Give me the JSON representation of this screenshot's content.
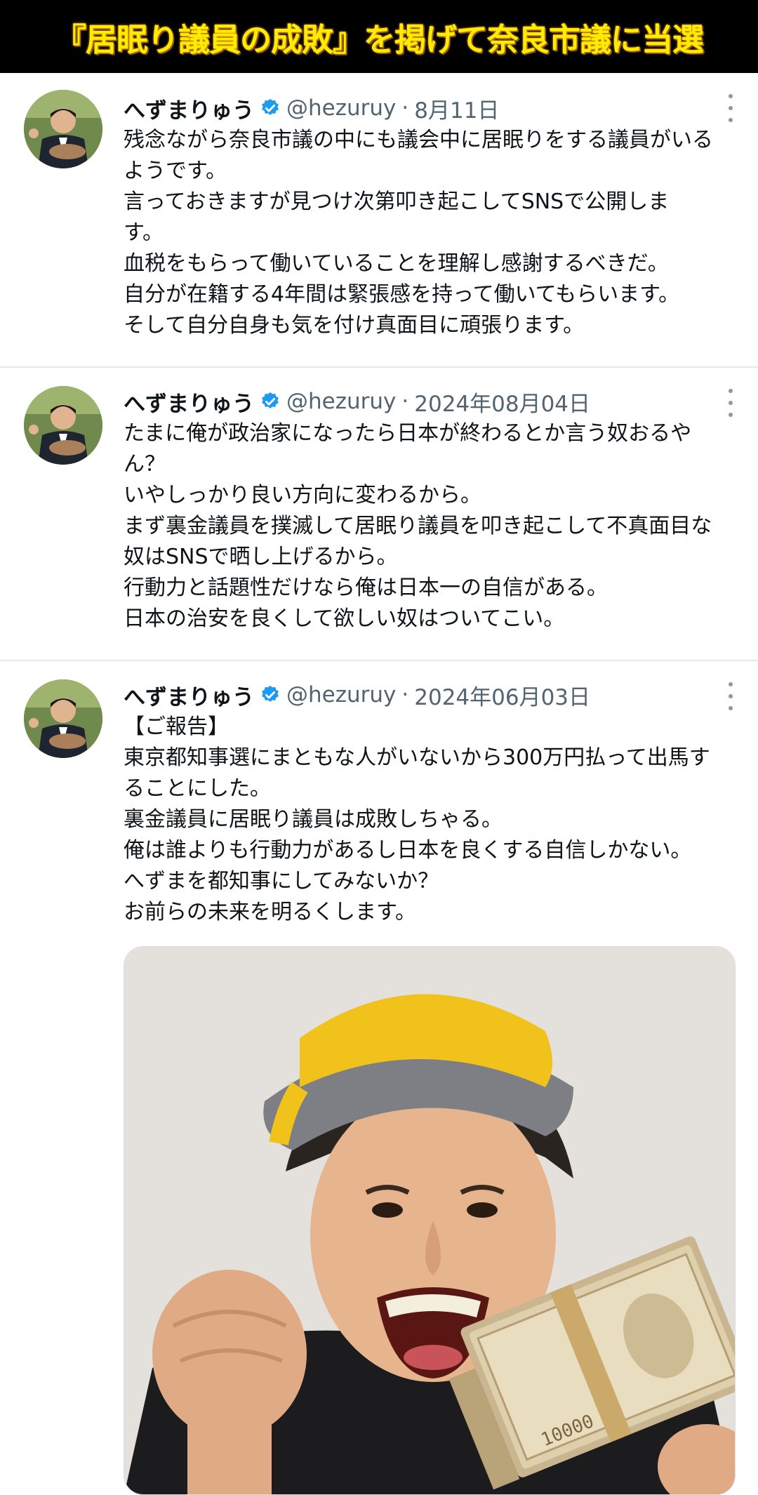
{
  "banner": {
    "title": "『居眠り議員の成敗』を掲げて奈良市議に当選"
  },
  "tweets": [
    {
      "name": "へずまりゅう",
      "handle": "@hezuruy",
      "dot": "·",
      "date": "8月11日",
      "text": "残念ながら奈良市議の中にも議会中に居眠りをする議員がいる\nようです。\n言っておきますが見つけ次第叩き起こしてSNSで公開しま\nす。\n血税をもらって働いていることを理解し感謝するべきだ。\n自分が在籍する4年間は緊張感を持って働いてもらいます。\nそして自分自身も気を付け真面目に頑張ります。"
    },
    {
      "name": "へずまりゅう",
      "handle": "@hezuruy",
      "dot": "·",
      "date": "2024年08月04日",
      "text": "たまに俺が政治家になったら日本が終わるとか言う奴おるや\nん？\nいやしっかり良い方向に変わるから。\nまず裏金議員を撲滅して居眠り議員を叩き起こして不真面目な\n奴はSNSで晒し上げるから。\n行動力と話題性だけなら俺は日本一の自信がある。\n日本の治安を良くして欲しい奴はついてこい。"
    },
    {
      "name": "へずまりゅう",
      "handle": "@hezuruy",
      "dot": "·",
      "date": "2024年06月03日",
      "text": "【ご報告】\n東京都知事選にまともな人がいないから300万円払って出馬す\nることにした。\n裏金議員に居眠り議員は成敗しちゃる。\n俺は誰よりも行動力があるし日本を良くする自信しかない。\nへずまを都知事にしてみないか？\nお前らの未来を明るくします。"
    }
  ],
  "icons": {
    "verified": "verified-badge-icon",
    "more": "more-options-icon",
    "verified_color": "#1d9bf0"
  },
  "media": {
    "bill_label": "10000"
  }
}
